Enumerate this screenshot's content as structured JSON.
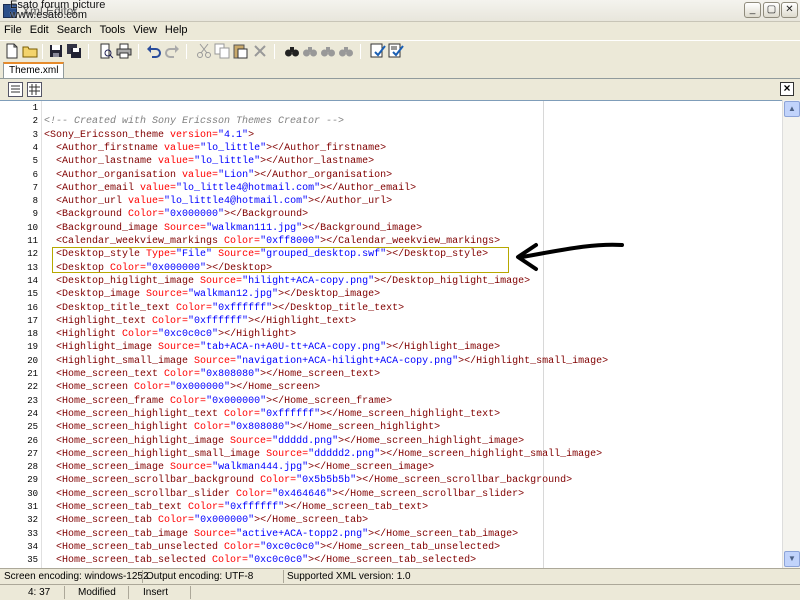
{
  "window": {
    "title": "Xml Editor",
    "watermark": "Esato forum picture\nwww.esato.com"
  },
  "menu": [
    "File",
    "Edit",
    "Search",
    "Tools",
    "View",
    "Help"
  ],
  "tab": {
    "label": "Theme.xml"
  },
  "editor": {
    "lines": [
      {
        "n": "1",
        "html": ""
      },
      {
        "n": "2",
        "html": "<span class='c'>&lt;!-- Created with Sony Ericsson Themes Creator --&gt;</span>"
      },
      {
        "n": "3",
        "html": "<span class='t'>&lt;Sony_Ericsson_theme </span><span class='a'>version=</span><span class='v'>\"4.1\"</span><span class='t'>&gt;</span>"
      },
      {
        "n": "4",
        "html": "  <span class='t'>&lt;Author_firstname </span><span class='a'>value=</span><span class='v'>\"lo_little\"</span><span class='t'>&gt;&lt;/Author_firstname&gt;</span>"
      },
      {
        "n": "5",
        "html": "  <span class='t'>&lt;Author_lastname </span><span class='a'>value=</span><span class='v'>\"lo_little\"</span><span class='t'>&gt;&lt;/Author_lastname&gt;</span>"
      },
      {
        "n": "6",
        "html": "  <span class='t'>&lt;Author_organisation </span><span class='a'>value=</span><span class='v'>\"Lion\"</span><span class='t'>&gt;&lt;/Author_organisation&gt;</span>"
      },
      {
        "n": "7",
        "html": "  <span class='t'>&lt;Author_email </span><span class='a'>value=</span><span class='v'>\"lo_little4@hotmail.com\"</span><span class='t'>&gt;&lt;/Author_email&gt;</span>"
      },
      {
        "n": "8",
        "html": "  <span class='t'>&lt;Author_url </span><span class='a'>value=</span><span class='v'>\"lo_little4@hotmail.com\"</span><span class='t'>&gt;&lt;/Author_url&gt;</span>"
      },
      {
        "n": "9",
        "html": "  <span class='t'>&lt;Background </span><span class='a'>Color=</span><span class='v'>\"0x000000\"</span><span class='t'>&gt;&lt;/Background&gt;</span>"
      },
      {
        "n": "10",
        "html": "  <span class='t'>&lt;Background_image </span><span class='a'>Source=</span><span class='v'>\"walkman111.jpg\"</span><span class='t'>&gt;&lt;/Background_image&gt;</span>"
      },
      {
        "n": "11",
        "html": "  <span class='t'>&lt;Calendar_weekview_markings </span><span class='a'>Color=</span><span class='v'>\"0xff8000\"</span><span class='t'>&gt;&lt;/Calendar_weekview_markings&gt;</span>"
      },
      {
        "n": "12",
        "html": "  <span class='t'>&lt;Desktop_style </span><span class='a'>Type=</span><span class='v'>\"File\"</span><span class='a'> Source=</span><span class='v'>\"grouped_desktop.swf\"</span><span class='t'>&gt;&lt;/Desktop_style&gt;</span>"
      },
      {
        "n": "13",
        "html": "  <span class='t'>&lt;Desktop </span><span class='a'>Color=</span><span class='v'>\"0x000000\"</span><span class='t'>&gt;&lt;/Desktop&gt;</span>"
      },
      {
        "n": "14",
        "html": "  <span class='t'>&lt;Desktop_higlight_image </span><span class='a'>Source=</span><span class='v'>\"hilight+ACA-copy.png\"</span><span class='t'>&gt;&lt;/Desktop_higlight_image&gt;</span>"
      },
      {
        "n": "15",
        "html": "  <span class='t'>&lt;Desktop_image </span><span class='a'>Source=</span><span class='v'>\"walkman12.jpg\"</span><span class='t'>&gt;&lt;/Desktop_image&gt;</span>"
      },
      {
        "n": "16",
        "html": "  <span class='t'>&lt;Desktop_title_text </span><span class='a'>Color=</span><span class='v'>\"0xffffff\"</span><span class='t'>&gt;&lt;/Desktop_title_text&gt;</span>"
      },
      {
        "n": "17",
        "html": "  <span class='t'>&lt;Highlight_text </span><span class='a'>Color=</span><span class='v'>\"0xffffff\"</span><span class='t'>&gt;&lt;/Highlight_text&gt;</span>"
      },
      {
        "n": "18",
        "html": "  <span class='t'>&lt;Highlight </span><span class='a'>Color=</span><span class='v'>\"0xc0c0c0\"</span><span class='t'>&gt;&lt;/Highlight&gt;</span>"
      },
      {
        "n": "19",
        "html": "  <span class='t'>&lt;Highlight_image </span><span class='a'>Source=</span><span class='v'>\"tab+ACA-n+A0U-tt+ACA-copy.png\"</span><span class='t'>&gt;&lt;/Highlight_image&gt;</span>"
      },
      {
        "n": "20",
        "html": "  <span class='t'>&lt;Highlight_small_image </span><span class='a'>Source=</span><span class='v'>\"navigation+ACA-hilight+ACA-copy.png\"</span><span class='t'>&gt;&lt;/Highlight_small_image&gt;</span>"
      },
      {
        "n": "21",
        "html": "  <span class='t'>&lt;Home_screen_text </span><span class='a'>Color=</span><span class='v'>\"0x808080\"</span><span class='t'>&gt;&lt;/Home_screen_text&gt;</span>"
      },
      {
        "n": "22",
        "html": "  <span class='t'>&lt;Home_screen </span><span class='a'>Color=</span><span class='v'>\"0x000000\"</span><span class='t'>&gt;&lt;/Home_screen&gt;</span>"
      },
      {
        "n": "23",
        "html": "  <span class='t'>&lt;Home_screen_frame </span><span class='a'>Color=</span><span class='v'>\"0x000000\"</span><span class='t'>&gt;&lt;/Home_screen_frame&gt;</span>"
      },
      {
        "n": "24",
        "html": "  <span class='t'>&lt;Home_screen_highlight_text </span><span class='a'>Color=</span><span class='v'>\"0xffffff\"</span><span class='t'>&gt;&lt;/Home_screen_highlight_text&gt;</span>"
      },
      {
        "n": "25",
        "html": "  <span class='t'>&lt;Home_screen_highlight </span><span class='a'>Color=</span><span class='v'>\"0x808080\"</span><span class='t'>&gt;&lt;/Home_screen_highlight&gt;</span>"
      },
      {
        "n": "26",
        "html": "  <span class='t'>&lt;Home_screen_highlight_image </span><span class='a'>Source=</span><span class='v'>\"ddddd.png\"</span><span class='t'>&gt;&lt;/Home_screen_highlight_image&gt;</span>"
      },
      {
        "n": "27",
        "html": "  <span class='t'>&lt;Home_screen_highlight_small_image </span><span class='a'>Source=</span><span class='v'>\"ddddd2.png\"</span><span class='t'>&gt;&lt;/Home_screen_highlight_small_image&gt;</span>"
      },
      {
        "n": "28",
        "html": "  <span class='t'>&lt;Home_screen_image </span><span class='a'>Source=</span><span class='v'>\"walkman444.jpg\"</span><span class='t'>&gt;&lt;/Home_screen_image&gt;</span>"
      },
      {
        "n": "29",
        "html": "  <span class='t'>&lt;Home_screen_scrollbar_background </span><span class='a'>Color=</span><span class='v'>\"0x5b5b5b\"</span><span class='t'>&gt;&lt;/Home_screen_scrollbar_background&gt;</span>"
      },
      {
        "n": "30",
        "html": "  <span class='t'>&lt;Home_screen_scrollbar_slider </span><span class='a'>Color=</span><span class='v'>\"0x464646\"</span><span class='t'>&gt;&lt;/Home_screen_scrollbar_slider&gt;</span>"
      },
      {
        "n": "31",
        "html": "  <span class='t'>&lt;Home_screen_tab_text </span><span class='a'>Color=</span><span class='v'>\"0xffffff\"</span><span class='t'>&gt;&lt;/Home_screen_tab_text&gt;</span>"
      },
      {
        "n": "32",
        "html": "  <span class='t'>&lt;Home_screen_tab </span><span class='a'>Color=</span><span class='v'>\"0x000000\"</span><span class='t'>&gt;&lt;/Home_screen_tab&gt;</span>"
      },
      {
        "n": "33",
        "html": "  <span class='t'>&lt;Home_screen_tab_image </span><span class='a'>Source=</span><span class='v'>\"active+ACA-topp2.png\"</span><span class='t'>&gt;&lt;/Home_screen_tab_image&gt;</span>"
      },
      {
        "n": "34",
        "html": "  <span class='t'>&lt;Home_screen_tab_unselected </span><span class='a'>Color=</span><span class='v'>\"0xc0c0c0\"</span><span class='t'>&gt;&lt;/Home_screen_tab_unselected&gt;</span>"
      },
      {
        "n": "35",
        "html": "  <span class='t'>&lt;Home_screen_tab_selected </span><span class='a'>Color=</span><span class='v'>\"0xc0c0c0\"</span><span class='t'>&gt;&lt;/Home_screen_tab_selected&gt;</span>"
      }
    ]
  },
  "status": {
    "screen_encoding": "Screen encoding: windows-1252",
    "output_encoding": "Output encoding: UTF-8",
    "xml_version": "Supported XML version: 1.0",
    "cursor": "4: 37",
    "modified": "Modified",
    "mode": "Insert"
  },
  "colors": {
    "tag": "#800000",
    "attribute": "#ff0000",
    "value": "#0000ff",
    "comment": "#808080",
    "highlight_border": "#b7a800"
  }
}
